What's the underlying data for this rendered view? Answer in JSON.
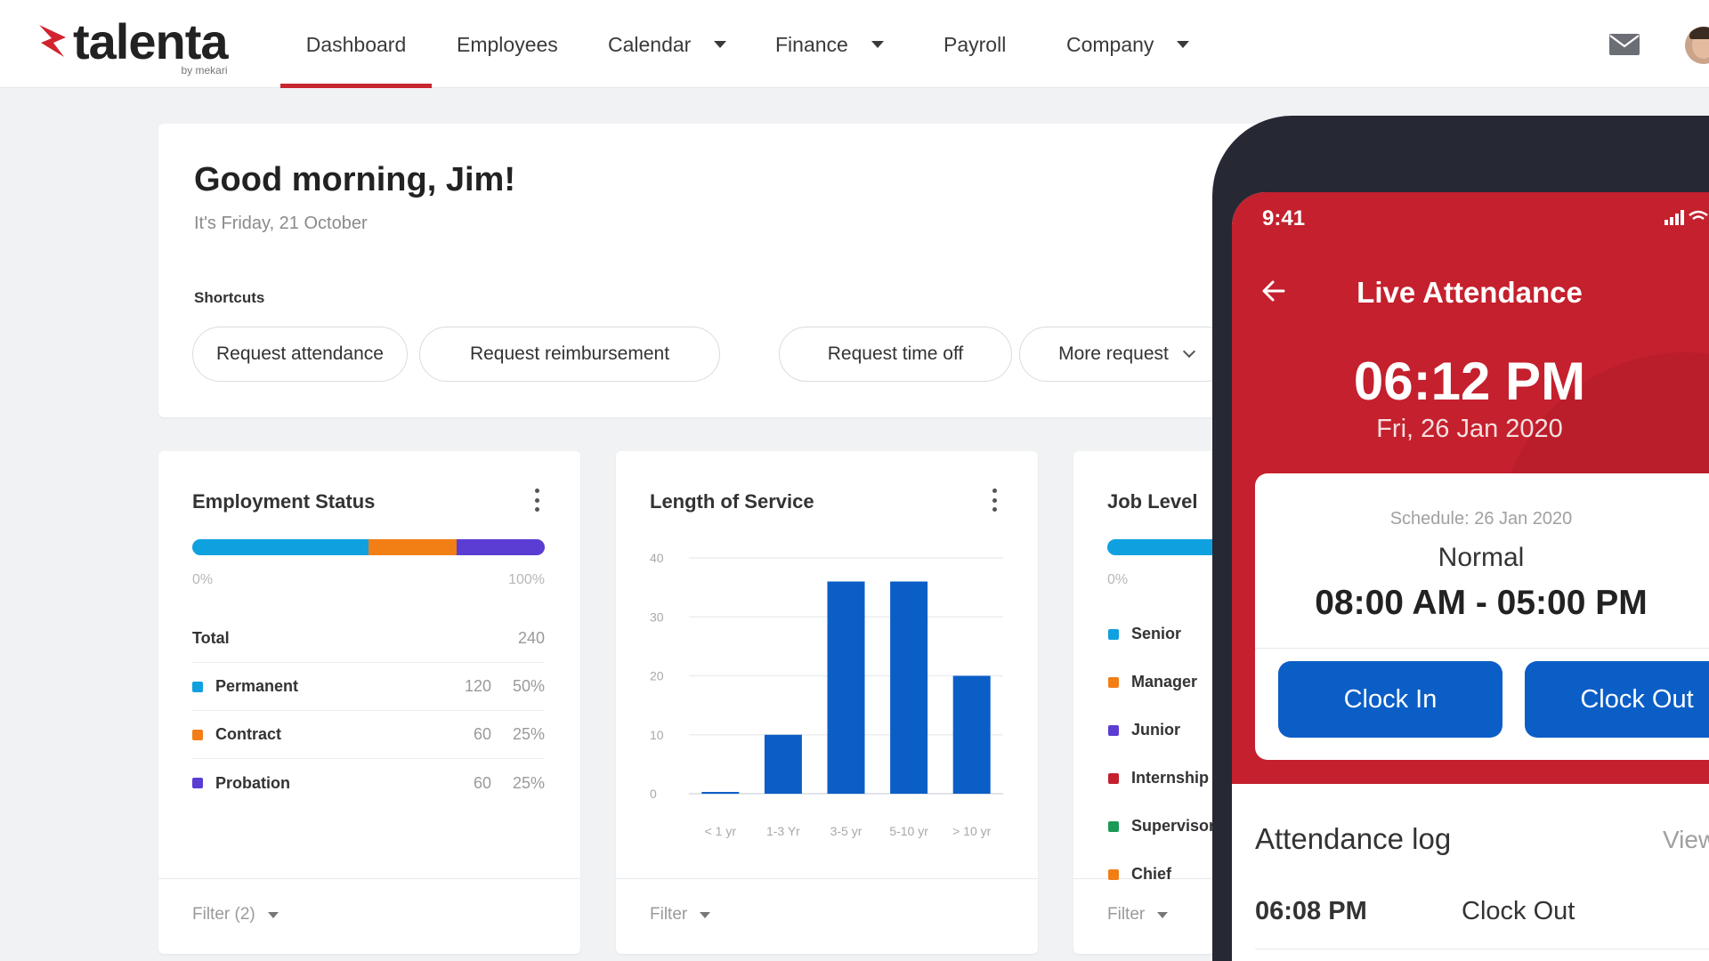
{
  "brand": {
    "name": "talenta",
    "byline": "by mekari",
    "accent": "#c8262f"
  },
  "nav": {
    "items": [
      {
        "label": "Dashboard",
        "active": true,
        "dropdown": false
      },
      {
        "label": "Employees",
        "active": false,
        "dropdown": false
      },
      {
        "label": "Calendar",
        "active": false,
        "dropdown": true
      },
      {
        "label": "Finance",
        "active": false,
        "dropdown": true
      },
      {
        "label": "Payroll",
        "active": false,
        "dropdown": false
      },
      {
        "label": "Company",
        "active": false,
        "dropdown": true
      }
    ],
    "icons": [
      "mail-icon",
      "avatar"
    ]
  },
  "greeting": {
    "title": "Good morning, Jim!",
    "date": "It's Friday, 21 October",
    "shortcuts_label": "Shortcuts",
    "shortcuts": [
      "Request attendance",
      "Request reimbursement",
      "Request time off",
      "More request"
    ]
  },
  "employment_status": {
    "title": "Employment Status",
    "axis_min": "0%",
    "axis_max": "100%",
    "total_label": "Total",
    "total_value": "240",
    "rows": [
      {
        "label": "Permanent",
        "count": "120",
        "percent": "50%",
        "color": "#0fa0e0"
      },
      {
        "label": "Contract",
        "count": "60",
        "percent": "25%",
        "color": "#f27e16"
      },
      {
        "label": "Probation",
        "count": "60",
        "percent": "25%",
        "color": "#5b3dd3"
      }
    ],
    "filter": "Filter (2)"
  },
  "length_of_service": {
    "title": "Length of Service",
    "filter": "Filter",
    "bar_color": "#0b5ec6"
  },
  "job_level": {
    "title": "Job Level",
    "axis_min": "0%",
    "items": [
      {
        "label": "Senior",
        "color": "#0fa0e0"
      },
      {
        "label": "Manager",
        "color": "#f27e16"
      },
      {
        "label": "Junior",
        "color": "#5b3dd3"
      },
      {
        "label": "Internship",
        "color": "#c4202d"
      },
      {
        "label": "Supervisor",
        "color": "#1a9a56"
      },
      {
        "label": "Chief",
        "color": "#f27e16"
      }
    ],
    "filter": "Filter"
  },
  "phone": {
    "status_time": "9:41",
    "title": "Live Attendance",
    "time": "06:12 PM",
    "date": "Fri, 26 Jan 2020",
    "schedule_label": "Schedule: 26 Jan 2020",
    "schedule_type": "Normal",
    "schedule_hours": "08:00 AM - 05:00 PM",
    "clock_in": "Clock In",
    "clock_out": "Clock Out",
    "log_title": "Attendance log",
    "log_view": "View",
    "log_entries": [
      {
        "time": "06:08 PM",
        "type": "Clock Out"
      }
    ],
    "accent": "#c4202d",
    "button_color": "#0b5ec6"
  },
  "chart_data": {
    "type": "bar",
    "title": "Length of Service",
    "categories": [
      "< 1 yr",
      "1-3 Yr",
      "3-5 yr",
      "5-10 yr",
      "> 10 yr"
    ],
    "values": [
      0.3,
      10,
      36,
      36,
      20
    ],
    "ylim": [
      0,
      40
    ],
    "yticks": [
      0,
      10,
      20,
      30,
      40
    ],
    "grid": true
  }
}
